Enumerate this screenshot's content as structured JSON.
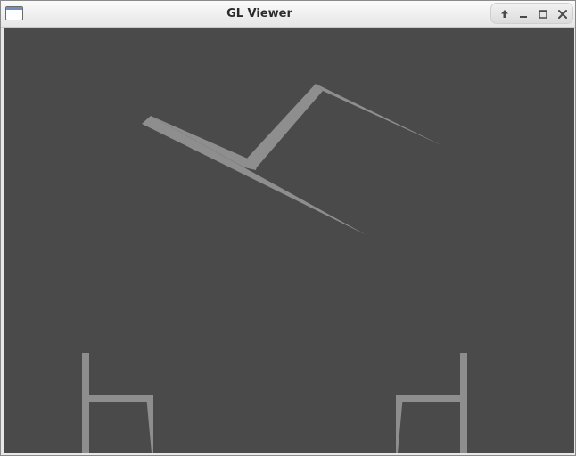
{
  "window": {
    "title": "GL Viewer",
    "controls": {
      "up_icon": "arrow-up-icon",
      "minimize_icon": "minimize-icon",
      "maximize_icon": "maximize-icon",
      "close_icon": "close-icon"
    }
  },
  "colors": {
    "viewport_background": "#4a4a4a",
    "geometry_fill": "#8e8e8e",
    "titlebar_text": "#2b2b2b"
  }
}
